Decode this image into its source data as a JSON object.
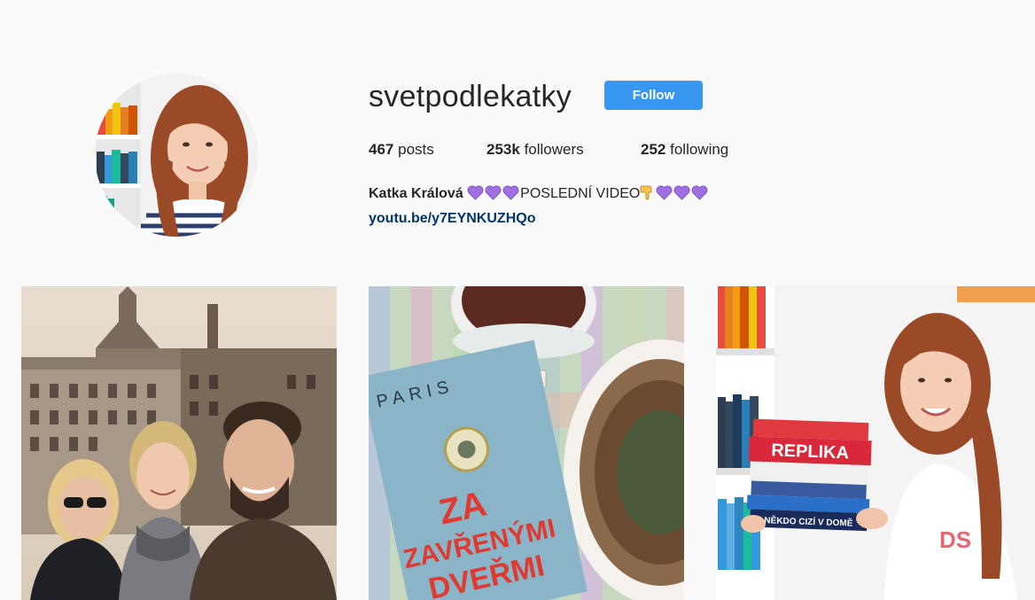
{
  "profile": {
    "username": "svetpodlekatky",
    "follow_label": "Follow",
    "stats": {
      "posts_count": "467",
      "posts_label": "posts",
      "followers_count": "253k",
      "followers_label": "followers",
      "following_count": "252",
      "following_label": "following"
    },
    "bio": {
      "full_name": "Katka Králová",
      "text": "POSLEDNÍ VIDEO",
      "link": "youtu.be/y7EYNKUZHQo"
    }
  },
  "posts": [
    {
      "icon": "group-selfie-photo"
    },
    {
      "icon": "book-tea-cake-photo",
      "book_cover": {
        "top": "PARIS",
        "title_line1": "ZA",
        "title_line2": "ZAVŘENÝMI",
        "title_line3": "DVEŘMI"
      }
    },
    {
      "icon": "girl-with-books-photo",
      "book_spines": [
        "REPLIKA",
        "NĚKDO CIZÍ V DOMĚ"
      ]
    }
  ],
  "colors": {
    "accent": "#3897f0",
    "link": "#003569",
    "heart": "#a070e0",
    "background": "#fafafa"
  }
}
